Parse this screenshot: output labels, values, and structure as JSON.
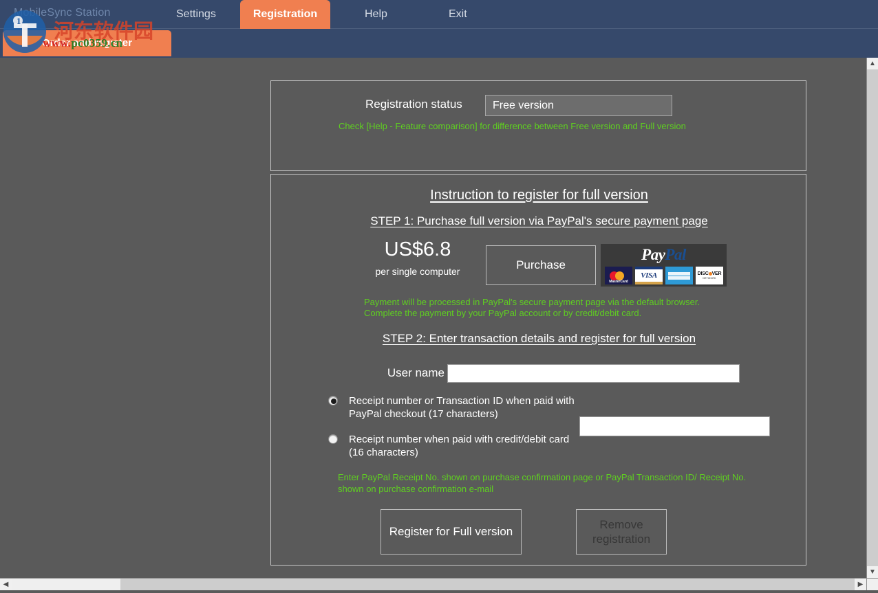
{
  "app": {
    "title": "MobileSync Station"
  },
  "nav": {
    "tabs": [
      {
        "label": "Settings",
        "active": false
      },
      {
        "label": "Registration",
        "active": true
      },
      {
        "label": "Help",
        "active": false
      },
      {
        "label": "Exit",
        "active": false
      }
    ],
    "subtab": "Order and register"
  },
  "watermark": {
    "site_cn": "河东软件园",
    "url_red": "www.",
    "url_mid": "pc0359",
    "url_end": ".cn"
  },
  "status_panel": {
    "label": "Registration status",
    "value": "Free version",
    "hint": "Check [Help - Feature comparison] for difference between Free version and Full version",
    "hint_color": "#5fd020"
  },
  "instructions": {
    "title": "Instruction to register for full version",
    "step1_head": "STEP 1: Purchase full version via PayPal's secure payment page",
    "price": "US$6.8",
    "price_sub": "per single computer",
    "purchase_button": "Purchase",
    "paypal_logo": {
      "word_pay": "Pay",
      "word_pal": "Pal",
      "cards": [
        "MasterCard",
        "VISA",
        "AMERICAN EXPRESS",
        "DISCOVER"
      ]
    },
    "payment_note": "Payment will be processed in PayPal's secure payment page via the default browser. Complete the payment by your PayPal account or by credit/debit card.",
    "step2_head": "STEP 2: Enter transaction details and register for full version",
    "username_label": "User name",
    "username_value": "",
    "username_placeholder": "",
    "radio_options": [
      {
        "label": "Receipt number or Transaction ID when paid with PayPal checkout (17 characters)",
        "selected": true
      },
      {
        "label": "Receipt number when paid with credit/debit card (16 characters)",
        "selected": false
      }
    ],
    "receipt_value": "",
    "receipt_placeholder": "",
    "receipt_note": "Enter PayPal Receipt No. shown on purchase confirmation page or PayPal Transaction ID/ Receipt No. shown on purchase confirmation e-mail",
    "register_button": "Register for Full version",
    "remove_button": "Remove registration"
  },
  "scrollbars": {
    "up_arrow": "▲",
    "down_arrow": "▼",
    "left_arrow": "◀",
    "right_arrow": "▶"
  },
  "colors": {
    "header_bg": "#36496b",
    "accent_orange": "#f07f50",
    "body_bg": "#5a5a5a",
    "green_text": "#5fd020"
  }
}
